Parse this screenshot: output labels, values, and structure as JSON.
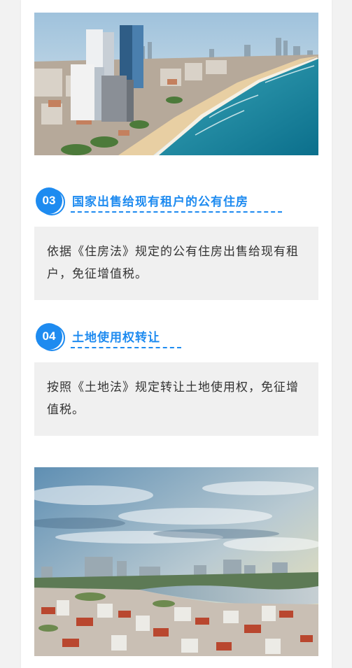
{
  "sections": [
    {
      "number": "03",
      "title": "国家出售给现有租户的公有住房",
      "text": "依据《住房法》规定的公有住房出售给现有租户，免征增值税。"
    },
    {
      "number": "04",
      "title": "土地使用权转让",
      "text": "按照《土地法》规定转让土地使用权，免征增值税。"
    }
  ],
  "colors": {
    "accent": "#1e8bf0",
    "box_bg": "#f0f0f0",
    "text": "#333333"
  }
}
